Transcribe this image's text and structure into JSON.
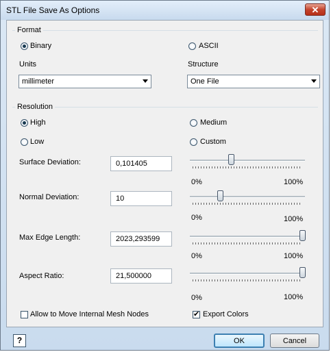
{
  "window": {
    "title": "STL File Save As Options",
    "close_label": "✕"
  },
  "format": {
    "label": "Format",
    "binary_label": "Binary",
    "ascii_label": "ASCII",
    "selected": "Binary",
    "units_label": "Units",
    "units_value": "millimeter",
    "structure_label": "Structure",
    "structure_value": "One File"
  },
  "resolution": {
    "label": "Resolution",
    "options": [
      "High",
      "Medium",
      "Low",
      "Custom"
    ],
    "selected": "High",
    "params": [
      {
        "label": "Surface Deviation:",
        "value": "0,101405",
        "slider_fraction": 0.35
      },
      {
        "label": "Normal Deviation:",
        "value": "10",
        "slider_fraction": 0.25
      },
      {
        "label": "Max Edge Length:",
        "value": "2023,293599",
        "slider_fraction": 1.0
      },
      {
        "label": "Aspect Ratio:",
        "value": "21,500000",
        "slider_fraction": 1.0
      }
    ],
    "slider_min_label": "0%",
    "slider_max_label": "100%"
  },
  "options": {
    "move_nodes_label": "Allow to Move Internal Mesh Nodes",
    "move_nodes_checked": false,
    "export_colors_label": "Export Colors",
    "export_colors_checked": true
  },
  "footer": {
    "help_label": "?",
    "ok_label": "OK",
    "cancel_label": "Cancel"
  },
  "icons": {
    "help": "help-icon",
    "close": "close-icon"
  }
}
